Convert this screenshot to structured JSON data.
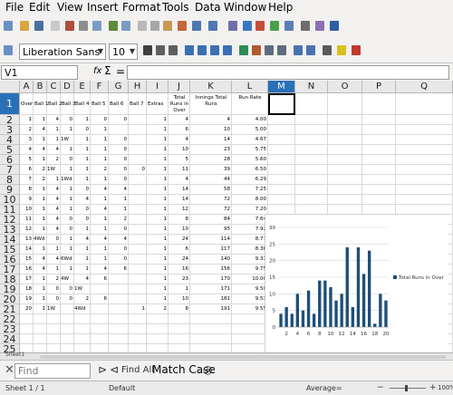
{
  "menubar": {
    "items": [
      "File",
      "Edit",
      "View",
      "Insert",
      "Format",
      "Tools",
      "Data",
      "Window",
      "Help"
    ]
  },
  "format_toolbar": {
    "font_name": "Liberation Sans",
    "font_size": "10"
  },
  "formula_bar": {
    "name_box": "V1",
    "fx_label": "fx",
    "sum_symbol": "Σ",
    "equals_symbol": "=",
    "formula": ""
  },
  "grid": {
    "columns": [
      "A",
      "B",
      "C",
      "D",
      "E",
      "F",
      "G",
      "H",
      "I",
      "J",
      "K",
      "L",
      "M",
      "N",
      "O",
      "P",
      "Q"
    ],
    "active_column": "M",
    "active_row": "1",
    "headers": [
      "Over",
      "Ball 1",
      "Ball 2",
      "Ball 3",
      "Ball 4",
      "Ball 5",
      "Ball 6",
      "Ball 7",
      "Extras",
      "Total Runs in Over",
      "Innings Total Runs",
      "Run Rate"
    ],
    "rows": [
      [
        "1",
        "1",
        "4",
        "0",
        "1",
        "0",
        "0",
        "",
        "1",
        "4",
        "4",
        "4.00"
      ],
      [
        "2",
        "4",
        "1",
        "1",
        "0",
        "1",
        "",
        "",
        "1",
        "6",
        "10",
        "5.00"
      ],
      [
        "3",
        "1",
        "1",
        "1W",
        "1",
        "1",
        "0",
        "",
        "1",
        "4",
        "14",
        "4.67"
      ],
      [
        "4",
        "4",
        "4",
        "1",
        "1",
        "1",
        "0",
        "",
        "1",
        "10",
        "23",
        "5.75"
      ],
      [
        "5",
        "1",
        "2",
        "0",
        "1",
        "1",
        "0",
        "",
        "1",
        "5",
        "28",
        "5.60"
      ],
      [
        "6",
        "2",
        "1W",
        "1",
        "1",
        "2",
        "0",
        "0",
        "1",
        "11",
        "39",
        "6.50"
      ],
      [
        "7",
        "2",
        "1",
        "1Wd",
        "1",
        "1",
        "0",
        "",
        "1",
        "4",
        "44",
        "6.29"
      ],
      [
        "8",
        "1",
        "4",
        "1",
        "0",
        "4",
        "4",
        "",
        "1",
        "14",
        "58",
        "7.25"
      ],
      [
        "9",
        "1",
        "4",
        "1",
        "4",
        "1",
        "1",
        "",
        "1",
        "14",
        "72",
        "8.00"
      ],
      [
        "10",
        "1",
        "4",
        "1",
        "0",
        "4",
        "1",
        "",
        "1",
        "12",
        "72",
        "7.20"
      ],
      [
        "11",
        "1",
        "4",
        "0",
        "0",
        "1",
        "2",
        "",
        "1",
        "8",
        "84",
        "7.64"
      ],
      [
        "12",
        "1",
        "4",
        "0",
        "1",
        "1",
        "0",
        "",
        "1",
        "10",
        "95",
        "7.92"
      ],
      [
        "13",
        "4Wd",
        "0",
        "1",
        "4",
        "4",
        "4",
        "",
        "1",
        "24",
        "114",
        "8.77"
      ],
      [
        "14",
        "1",
        "1",
        "1",
        "1",
        "1",
        "0",
        "",
        "1",
        "6",
        "117",
        "8.36"
      ],
      [
        "15",
        "4",
        "4",
        "6Wd",
        "1",
        "1",
        "0",
        "",
        "1",
        "24",
        "140",
        "9.33"
      ],
      [
        "16",
        "4",
        "1",
        "1",
        "1",
        "4",
        "6",
        "",
        "1",
        "16",
        "156",
        "9.75"
      ],
      [
        "17",
        "1",
        "2",
        "4W",
        "4",
        "6",
        "",
        "",
        "1",
        "23",
        "170",
        "10.00"
      ],
      [
        "18",
        "1",
        "0",
        "0",
        "1W",
        "",
        "",
        "",
        "1",
        "1",
        "171",
        "9.50"
      ],
      [
        "19",
        "1",
        "0",
        "0",
        "2",
        "6",
        "",
        "",
        "1",
        "10",
        "181",
        "9.53"
      ],
      [
        "20",
        "1",
        "1W",
        "",
        "4Wd",
        "",
        "",
        "1",
        "2",
        "8",
        "191",
        "9.55"
      ]
    ]
  },
  "chart_data": {
    "type": "bar",
    "categories": [
      "1",
      "2",
      "3",
      "4",
      "5",
      "6",
      "7",
      "8",
      "9",
      "10",
      "11",
      "12",
      "13",
      "14",
      "15",
      "16",
      "17",
      "18",
      "19",
      "20"
    ],
    "series": [
      {
        "name": "Total Runs in Over",
        "values": [
          4,
          6,
          4,
          10,
          5,
          11,
          4,
          14,
          14,
          12,
          8,
          10,
          24,
          6,
          24,
          16,
          23,
          1,
          10,
          8
        ]
      }
    ],
    "x_tick_labels": [
      "2",
      "4",
      "6",
      "8",
      "10",
      "12",
      "14",
      "16",
      "18",
      "20"
    ],
    "y_tick_labels": [
      "0",
      "5",
      "10",
      "15",
      "20",
      "25",
      "30"
    ],
    "ylim": [
      0,
      30
    ],
    "legend": "right",
    "color": "#1f4e79"
  },
  "sheet_tabs": {
    "active": "Sheet1"
  },
  "findbar": {
    "placeholder": "Find",
    "find_all": "Find All",
    "match_case": "Match Case"
  },
  "statusbar": {
    "sheet": "Sheet 1 / 1",
    "style": "Default",
    "sum": "Average=",
    "zoom": "100%"
  }
}
